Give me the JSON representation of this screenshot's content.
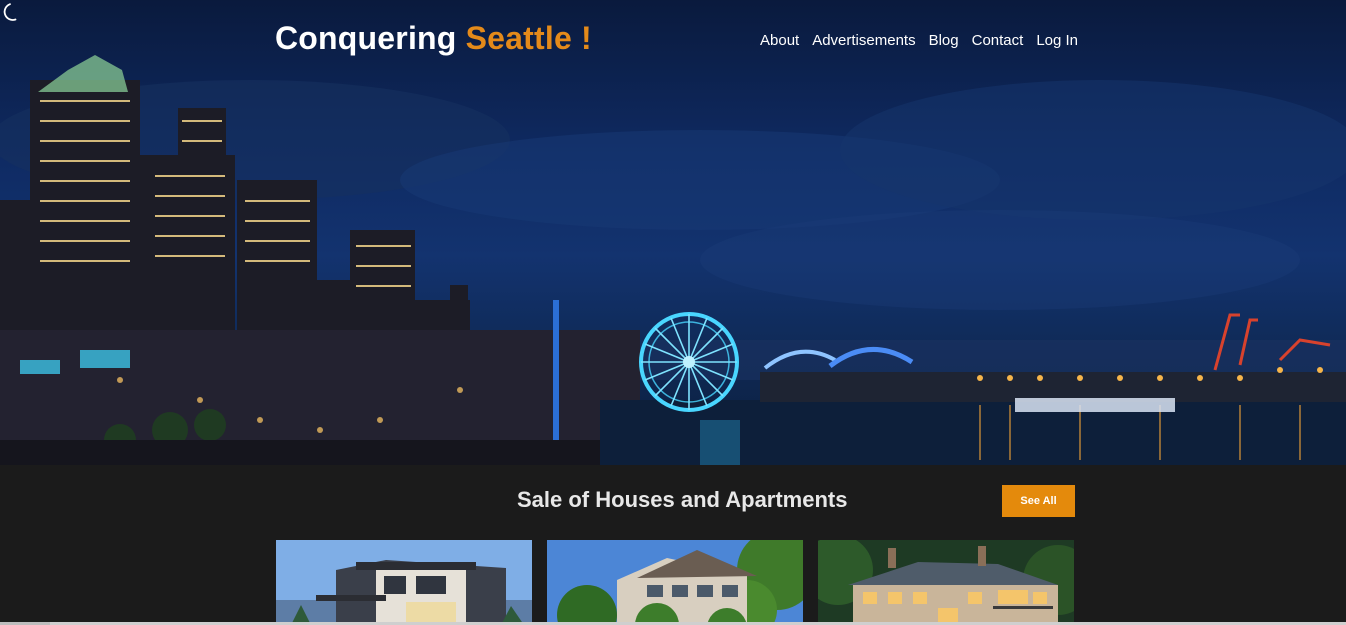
{
  "header": {
    "brand_main": "Conquering ",
    "brand_accent": "Seattle !",
    "theme_toggle_icon": "moon-icon",
    "nav": [
      "About",
      "Advertisements",
      "Blog",
      "Contact",
      "Log In"
    ]
  },
  "listings": {
    "title": "Sale of Houses and Apartments",
    "see_all_label": "See All",
    "cards": [
      {
        "image": "modern-house-photo"
      },
      {
        "image": "craftsman-house-photo"
      },
      {
        "image": "luxury-house-photo"
      }
    ]
  },
  "colors": {
    "accent": "#e48a1a",
    "button": "#e48a0c",
    "page_bg": "#1b1b1b"
  }
}
